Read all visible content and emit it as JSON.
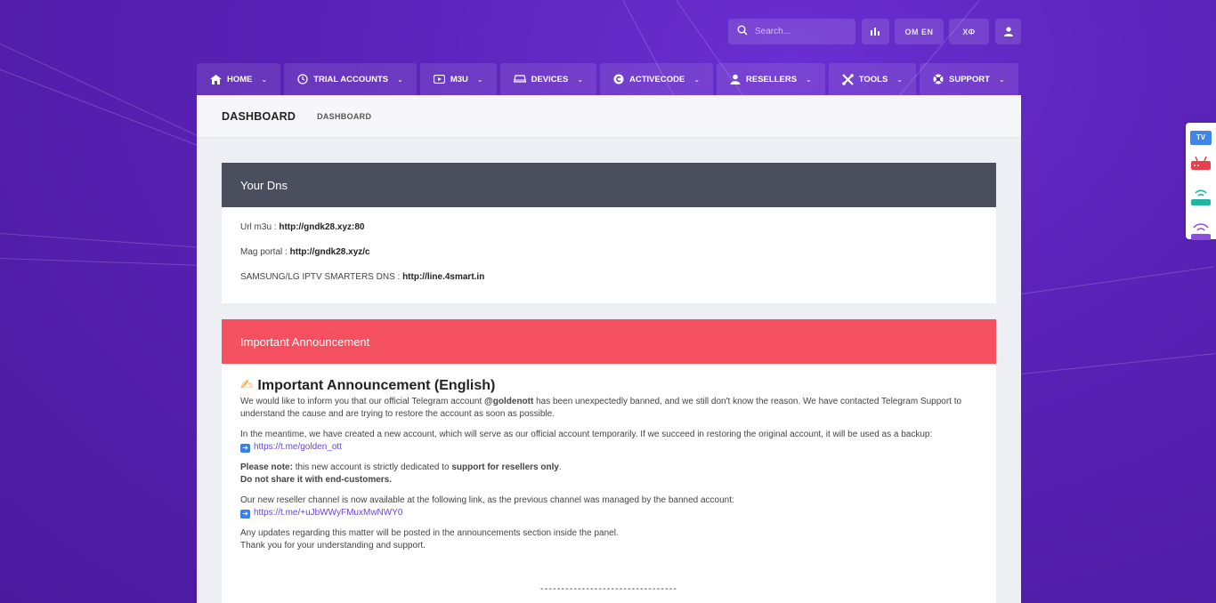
{
  "search": {
    "placeholder": "Search..."
  },
  "topbar": {
    "btn1_label": "OM EN",
    "btn2_label": "ХФ"
  },
  "nav": [
    {
      "label": "HOME"
    },
    {
      "label": "TRIAL ACCOUNTS"
    },
    {
      "label": "M3U"
    },
    {
      "label": "DEVICES"
    },
    {
      "label": "ACTIVECODE"
    },
    {
      "label": "RESELLERS"
    },
    {
      "label": "TOOLS"
    },
    {
      "label": "SUPPORT"
    }
  ],
  "subheader": {
    "title": "DASHBOARD",
    "breadcrumb": "DASHBOARD"
  },
  "dns": {
    "title": "Your Dns",
    "m3u_label": "Url m3u : ",
    "m3u_value": "http://gndk28.xyz:80",
    "mag_label": "Mag portal : ",
    "mag_value": "http://gndk28.xyz/c",
    "smarters_label": "SAMSUNG/LG IPTV SMARTERS DNS : ",
    "smarters_value": "http://line.4smart.in"
  },
  "announcement": {
    "header": "Important Announcement",
    "title_emoji": "✍",
    "title": "Important Announcement (English)",
    "p1_a": "We would like to inform you that our official Telegram account ",
    "p1_handle": "@goldenott",
    "p1_b": " has been unexpectedly banned, and we still don't know the reason. We have contacted Telegram Support to understand the cause and are trying to restore the account as soon as possible.",
    "p2": "In the meantime, we have created a new account, which will serve as our official account temporarily. If we succeed in restoring the original account, it will be used as a backup:",
    "p2_link": "https://t.me/golden_ott",
    "p3_note": "Please note:",
    "p3_a": " this new account is strictly dedicated to ",
    "p3_bold": "support for resellers only",
    "p3_b": ".",
    "p3_line2": "Do not share it with end-customers.",
    "p4": "Our new reseller channel is now available at the following link, as the previous channel was managed by the banned account:",
    "p4_link": "https://t.me/+uJbWWyFMuxMwNWY0",
    "p5_line1": "Any updates regarding this matter will be posted in the announcements section inside the panel.",
    "p5_line2": "Thank you for your understanding and support.",
    "dashes": "---------------------------------"
  },
  "side": {
    "tv_label": "TV"
  },
  "colors": {
    "background": "#5a21b5",
    "dns_header": "#4b4f5d",
    "announcement_header": "#f5505f",
    "link": "#6a44d6"
  }
}
